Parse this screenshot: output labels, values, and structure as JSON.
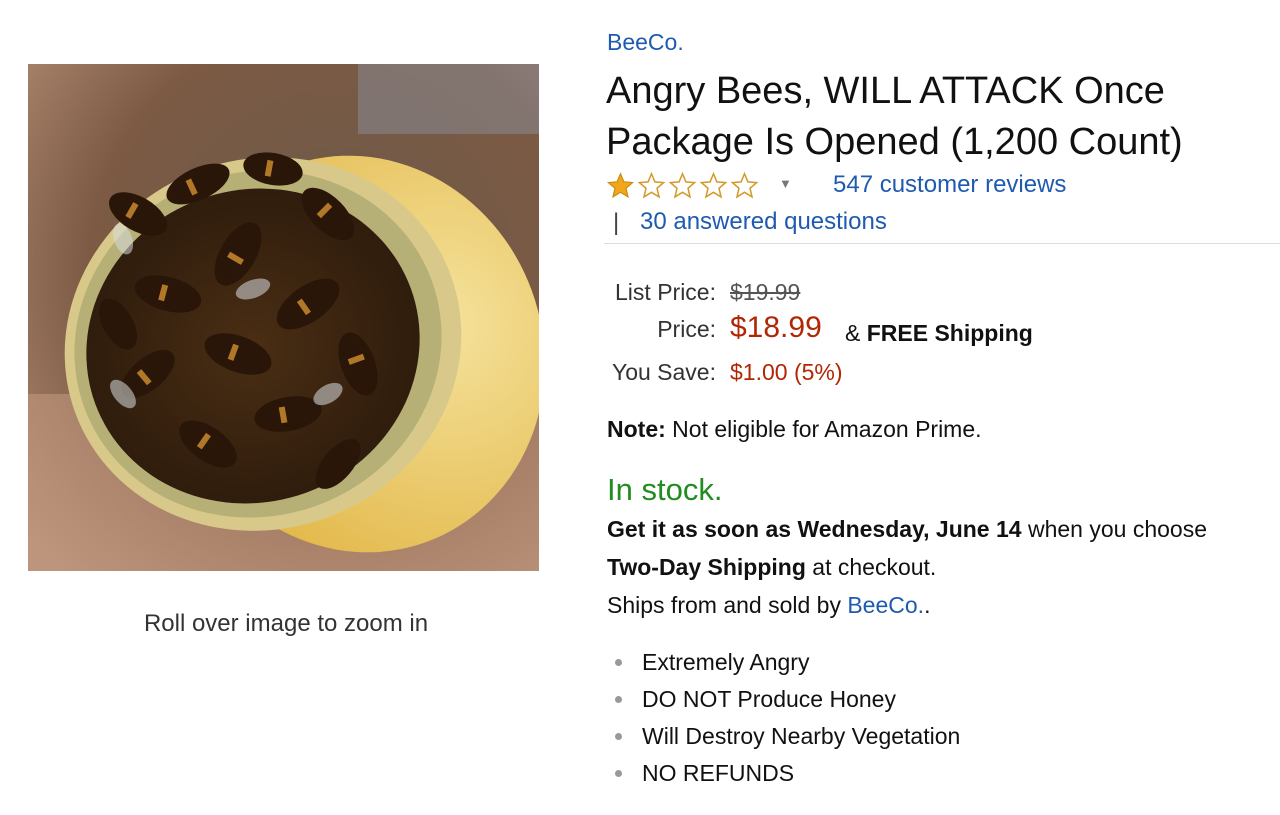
{
  "product": {
    "brand": "BeeCo.",
    "title": "Angry Bees, WILL ATTACK Once Package Is Opened (1,200 Count)",
    "image_hint": "Roll over image to zoom in",
    "rating_stars": 1,
    "rating_max": 5,
    "reviews_link": "547 customer reviews",
    "qa_separator": "|",
    "questions_link": "30 answered questions"
  },
  "pricing": {
    "list_price_label": "List Price:",
    "list_price": "$19.99",
    "price_label": "Price:",
    "price": "$18.99",
    "shipping_amp": "&",
    "shipping": "FREE Shipping",
    "you_save_label": "You Save:",
    "you_save": "$1.00 (5%)"
  },
  "note": {
    "label": "Note:",
    "text": "Not eligible for Amazon Prime."
  },
  "availability": {
    "status": "In stock.",
    "line1_bold": "Get it as soon as Wednesday, June 14",
    "line1_rest": "when you choose",
    "line2_bold": "Two-Day Shipping",
    "line2_rest": "at checkout.",
    "ships_from": "Ships from and sold by",
    "seller": "BeeCo.",
    "seller_suffix": "."
  },
  "features": [
    "Extremely Angry",
    "DO NOT Produce Honey",
    "Will Destroy Nearby Vegetation",
    "NO REFUNDS"
  ],
  "colors": {
    "link": "#1e5bb0",
    "price_red": "#b12704",
    "stock_green": "#218c21",
    "star_gold": "#f0a81a"
  },
  "icons": {
    "rating_dropdown": "caret-down-icon",
    "star": "star-icon"
  }
}
